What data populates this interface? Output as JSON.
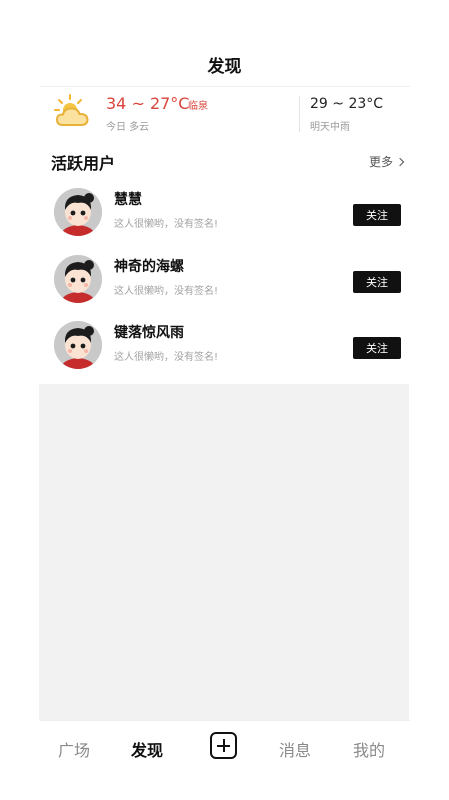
{
  "header": {
    "title": "发现"
  },
  "weather": {
    "today": {
      "range": "34 ~ 27°C",
      "city": "临泉",
      "desc": "今日 多云"
    },
    "tomorrow": {
      "range": "29 ~ 23°C",
      "desc": "明天中雨"
    },
    "icon": "partly-cloudy-icon",
    "accent_color": "#d9443b"
  },
  "active_users": {
    "title": "活跃用户",
    "more_label": "更多",
    "users": [
      {
        "name": "慧慧",
        "signature": "这人很懒哟，没有签名!",
        "follow_label": "关注"
      },
      {
        "name": "神奇的海螺",
        "signature": "这人很懒哟，没有签名!",
        "follow_label": "关注"
      },
      {
        "name": "键落惊风雨",
        "signature": "这人很懒哟，没有签名!",
        "follow_label": "关注"
      }
    ]
  },
  "tabbar": {
    "plaza": "广场",
    "discover": "发现",
    "add_icon": "plus-square-icon",
    "messages": "消息",
    "mine": "我的",
    "active": "discover"
  }
}
